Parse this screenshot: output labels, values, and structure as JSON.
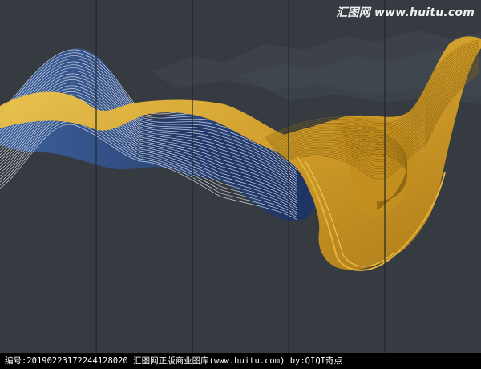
{
  "image": {
    "watermark_text": "汇图网 www.huitu.com",
    "footer_text": "编号:20190223172244128020  汇图网正版商业图库(www.huitu.com) by:QIQI奇点",
    "colors": {
      "background": "#363b42",
      "panel_line": "#23272c",
      "mountain": "#4a5159",
      "blue_ribbon": "#2e4a7e",
      "blue_ribbon_dark": "#1d3362",
      "white_lines": "#e6ebf2",
      "gold_ribbon": "#d8a32a",
      "gold_highlight": "#f3cf58",
      "gold_lines": "#8a6412",
      "footer_bg": "#000000",
      "footer_text": "#ffffff"
    },
    "panels": 5
  }
}
